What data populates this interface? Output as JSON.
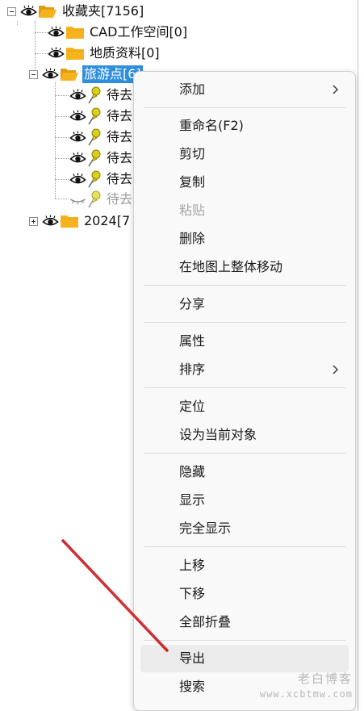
{
  "tree": {
    "root": {
      "label": "收藏夹[7156]"
    },
    "children": [
      {
        "label": "CAD工作空间[0]"
      },
      {
        "label": "地质资料[0]"
      },
      {
        "label": "旅游点[6]"
      }
    ],
    "sub_items": [
      {
        "label": "待去"
      },
      {
        "label": "待去"
      },
      {
        "label": "待去"
      },
      {
        "label": "待去"
      },
      {
        "label": "待去"
      },
      {
        "label": "待去"
      }
    ],
    "last": {
      "label": "2024[7"
    }
  },
  "menu": {
    "add": "添加",
    "rename": "重命名(F2)",
    "cut": "剪切",
    "copy": "复制",
    "paste": "粘贴",
    "delete": "删除",
    "move_on_map": "在地图上整体移动",
    "share": "分享",
    "properties": "属性",
    "sort": "排序",
    "locate": "定位",
    "set_current": "设为当前对象",
    "hide": "隐藏",
    "show": "显示",
    "show_all": "完全显示",
    "move_up": "上移",
    "move_down": "下移",
    "collapse_all": "全部折叠",
    "export": "导出",
    "search": "搜索"
  },
  "watermark": {
    "text": "老白博客",
    "url": "www.xcbtmw.com"
  },
  "colors": {
    "selection": "#2f8fdd",
    "folder": "#f6b31d",
    "pin": "#d9cf1f",
    "annotation_arrow": "#c8282d"
  }
}
